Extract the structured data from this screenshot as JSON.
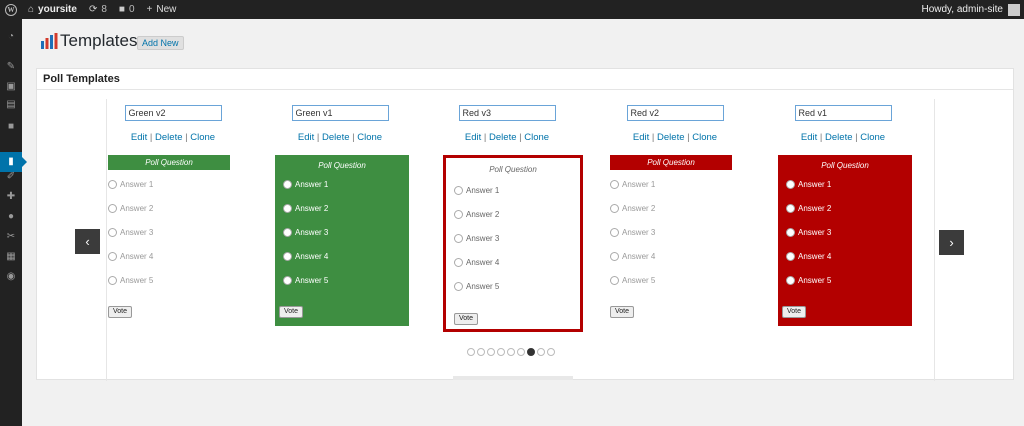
{
  "adminbar": {
    "site_name": "yoursite",
    "updates_count": "8",
    "comments_count": "0",
    "new_label": "New",
    "howdy": "Howdy, admin-site"
  },
  "header": {
    "title": "Templates",
    "add_new": "Add New"
  },
  "panel": {
    "title": "Poll Templates"
  },
  "links": {
    "edit": "Edit",
    "delete": "Delete",
    "clone": "Clone",
    "sep": "|"
  },
  "poll": {
    "question": "Poll Question",
    "answers": [
      "Answer 1",
      "Answer 2",
      "Answer 3",
      "Answer 4",
      "Answer 5"
    ],
    "vote": "Vote"
  },
  "templates": [
    {
      "name": "Green v2",
      "style": "header-bar",
      "color": "#3e8e41"
    },
    {
      "name": "Green v1",
      "style": "filled",
      "color": "#3e8e41"
    },
    {
      "name": "Red v3",
      "style": "bordered",
      "color": "#b30000"
    },
    {
      "name": "Red v2",
      "style": "header-bar",
      "color": "#b30000"
    },
    {
      "name": "Red v1",
      "style": "filled",
      "color": "#b30000"
    }
  ],
  "nav": {
    "prev": "‹",
    "next": "›"
  },
  "pagination": {
    "total": 9,
    "active": 7
  },
  "icons": {
    "wordpress": "wordpress-logo-icon",
    "home": "home-icon",
    "updates": "updates-icon",
    "comments": "comments-icon",
    "new": "plus-icon"
  }
}
